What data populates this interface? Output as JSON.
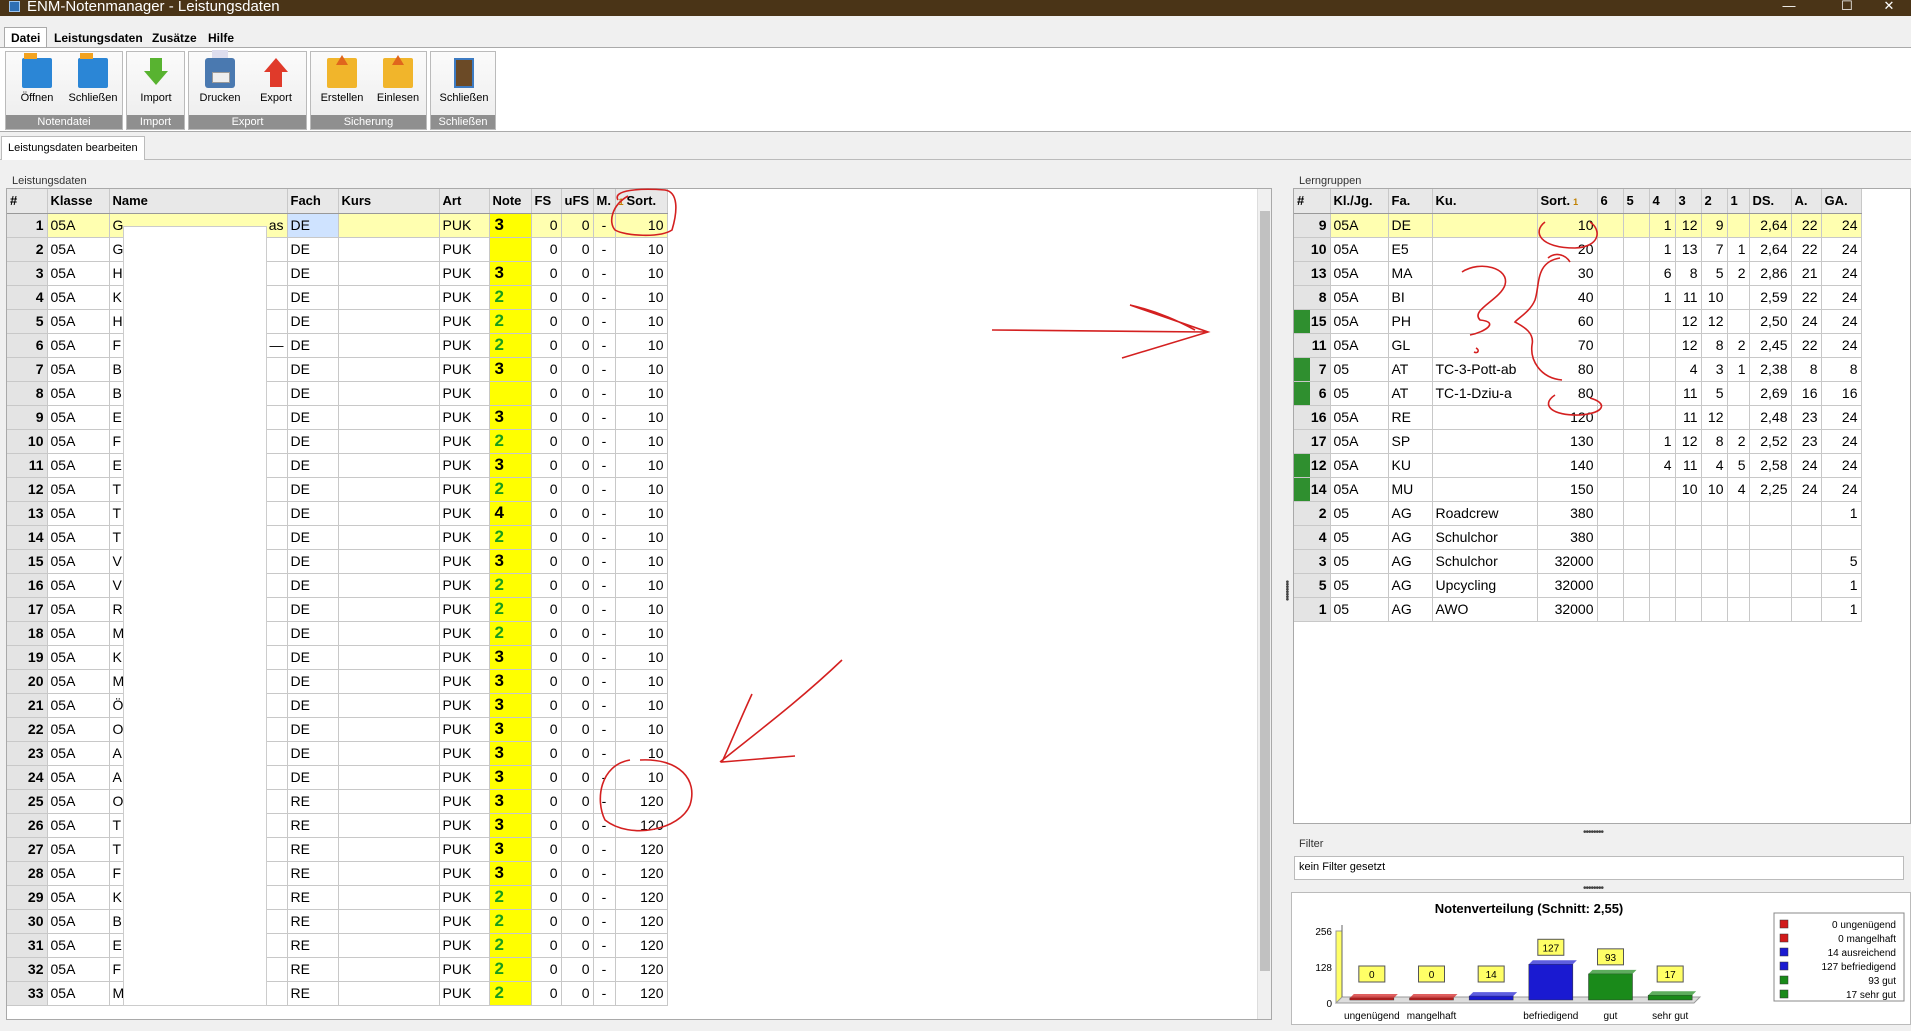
{
  "window": {
    "title": "ENM-Notenmanager - Leistungsdaten",
    "minimize": "—",
    "maximize": "☐",
    "close": "✕"
  },
  "menu": [
    "Datei",
    "Leistungsdaten",
    "Zusätze",
    "Hilfe"
  ],
  "ribbon": {
    "groups": [
      {
        "label": "Notendatei",
        "buttons": [
          {
            "label": "Öffnen",
            "icon": "folder-open-icon"
          },
          {
            "label": "Schließen",
            "icon": "folder-close-icon"
          }
        ]
      },
      {
        "label": "Import",
        "buttons": [
          {
            "label": "Import",
            "icon": "import-icon"
          }
        ]
      },
      {
        "label": "Export",
        "buttons": [
          {
            "label": "Drucken",
            "icon": "printer-icon"
          },
          {
            "label": "Export",
            "icon": "export-icon"
          }
        ]
      },
      {
        "label": "Sicherung",
        "buttons": [
          {
            "label": "Erstellen",
            "icon": "backup-create-icon"
          },
          {
            "label": "Einlesen",
            "icon": "backup-restore-icon"
          }
        ]
      },
      {
        "label": "Schließen",
        "buttons": [
          {
            "label": "Schließen",
            "icon": "door-exit-icon"
          }
        ]
      }
    ]
  },
  "subtab": "Leistungsdaten bearbeiten",
  "leistungsdaten": {
    "title": "Leistungsdaten",
    "headers": [
      "#",
      "Klasse",
      "Name",
      "Fach",
      "Kurs",
      "Art",
      "Note",
      "FS",
      "uFS",
      "M.",
      "Sort."
    ],
    "sort_indicator": "1",
    "name_fragments": {
      "1": "as",
      "6": "—"
    },
    "rows": [
      [
        "1",
        "05A",
        "G",
        "DE",
        "",
        "PUK",
        "3",
        "0",
        "0",
        "-",
        "10"
      ],
      [
        "2",
        "05A",
        "G",
        "DE",
        "",
        "PUK",
        "",
        "0",
        "0",
        "-",
        "10"
      ],
      [
        "3",
        "05A",
        "H",
        "DE",
        "",
        "PUK",
        "3",
        "0",
        "0",
        "-",
        "10"
      ],
      [
        "4",
        "05A",
        "K",
        "DE",
        "",
        "PUK",
        "2",
        "0",
        "0",
        "-",
        "10"
      ],
      [
        "5",
        "05A",
        "H",
        "DE",
        "",
        "PUK",
        "2",
        "0",
        "0",
        "-",
        "10"
      ],
      [
        "6",
        "05A",
        "F",
        "DE",
        "",
        "PUK",
        "2",
        "0",
        "0",
        "-",
        "10"
      ],
      [
        "7",
        "05A",
        "B",
        "DE",
        "",
        "PUK",
        "3",
        "0",
        "0",
        "-",
        "10"
      ],
      [
        "8",
        "05A",
        "B",
        "DE",
        "",
        "PUK",
        "",
        "0",
        "0",
        "-",
        "10"
      ],
      [
        "9",
        "05A",
        "E",
        "DE",
        "",
        "PUK",
        "3",
        "0",
        "0",
        "-",
        "10"
      ],
      [
        "10",
        "05A",
        "F",
        "DE",
        "",
        "PUK",
        "2",
        "0",
        "0",
        "-",
        "10"
      ],
      [
        "11",
        "05A",
        "E",
        "DE",
        "",
        "PUK",
        "3",
        "0",
        "0",
        "-",
        "10"
      ],
      [
        "12",
        "05A",
        "T",
        "DE",
        "",
        "PUK",
        "2",
        "0",
        "0",
        "-",
        "10"
      ],
      [
        "13",
        "05A",
        "T",
        "DE",
        "",
        "PUK",
        "4",
        "0",
        "0",
        "-",
        "10"
      ],
      [
        "14",
        "05A",
        "T",
        "DE",
        "",
        "PUK",
        "2",
        "0",
        "0",
        "-",
        "10"
      ],
      [
        "15",
        "05A",
        "V",
        "DE",
        "",
        "PUK",
        "3",
        "0",
        "0",
        "-",
        "10"
      ],
      [
        "16",
        "05A",
        "V",
        "DE",
        "",
        "PUK",
        "2",
        "0",
        "0",
        "-",
        "10"
      ],
      [
        "17",
        "05A",
        "R",
        "DE",
        "",
        "PUK",
        "2",
        "0",
        "0",
        "-",
        "10"
      ],
      [
        "18",
        "05A",
        "M",
        "DE",
        "",
        "PUK",
        "2",
        "0",
        "0",
        "-",
        "10"
      ],
      [
        "19",
        "05A",
        "K",
        "DE",
        "",
        "PUK",
        "3",
        "0",
        "0",
        "-",
        "10"
      ],
      [
        "20",
        "05A",
        "M",
        "DE",
        "",
        "PUK",
        "3",
        "0",
        "0",
        "-",
        "10"
      ],
      [
        "21",
        "05A",
        "Ö",
        "DE",
        "",
        "PUK",
        "3",
        "0",
        "0",
        "-",
        "10"
      ],
      [
        "22",
        "05A",
        "O",
        "DE",
        "",
        "PUK",
        "3",
        "0",
        "0",
        "-",
        "10"
      ],
      [
        "23",
        "05A",
        "A",
        "DE",
        "",
        "PUK",
        "3",
        "0",
        "0",
        "-",
        "10"
      ],
      [
        "24",
        "05A",
        "A",
        "DE",
        "",
        "PUK",
        "3",
        "0",
        "0",
        "-",
        "10"
      ],
      [
        "25",
        "05A",
        "O",
        "RE",
        "",
        "PUK",
        "3",
        "0",
        "0",
        "-",
        "120"
      ],
      [
        "26",
        "05A",
        "T",
        "RE",
        "",
        "PUK",
        "3",
        "0",
        "0",
        "-",
        "120"
      ],
      [
        "27",
        "05A",
        "T",
        "RE",
        "",
        "PUK",
        "3",
        "0",
        "0",
        "-",
        "120"
      ],
      [
        "28",
        "05A",
        "F",
        "RE",
        "",
        "PUK",
        "3",
        "0",
        "0",
        "-",
        "120"
      ],
      [
        "29",
        "05A",
        "K",
        "RE",
        "",
        "PUK",
        "2",
        "0",
        "0",
        "-",
        "120"
      ],
      [
        "30",
        "05A",
        "B",
        "RE",
        "",
        "PUK",
        "2",
        "0",
        "0",
        "-",
        "120"
      ],
      [
        "31",
        "05A",
        "E",
        "RE",
        "",
        "PUK",
        "2",
        "0",
        "0",
        "-",
        "120"
      ],
      [
        "32",
        "05A",
        "F",
        "RE",
        "",
        "PUK",
        "2",
        "0",
        "0",
        "-",
        "120"
      ],
      [
        "33",
        "05A",
        "M",
        "RE",
        "",
        "PUK",
        "2",
        "0",
        "0",
        "-",
        "120"
      ]
    ]
  },
  "lerngruppen": {
    "title": "Lerngruppen",
    "headers": [
      "#",
      "Kl./Jg.",
      "Fa.",
      "Ku.",
      "Sort.",
      "6",
      "5",
      "4",
      "3",
      "2",
      "1",
      "DS.",
      "A.",
      "GA."
    ],
    "sort_indicator": "1",
    "rows": [
      [
        "9",
        "05A",
        "DE",
        "",
        "10",
        "",
        "",
        "1",
        "12",
        "9",
        "",
        "2,64",
        "22",
        "24"
      ],
      [
        "10",
        "05A",
        "E5",
        "",
        "20",
        "",
        "",
        "1",
        "13",
        "7",
        "1",
        "2,64",
        "22",
        "24"
      ],
      [
        "13",
        "05A",
        "MA",
        "",
        "30",
        "",
        "",
        "6",
        "8",
        "5",
        "2",
        "2,86",
        "21",
        "24"
      ],
      [
        "8",
        "05A",
        "BI",
        "",
        "40",
        "",
        "",
        "1",
        "11",
        "10",
        "",
        "2,59",
        "22",
        "24"
      ],
      [
        "15",
        "05A",
        "PH",
        "",
        "60",
        "",
        "",
        "",
        "12",
        "12",
        "",
        "2,50",
        "24",
        "24"
      ],
      [
        "11",
        "05A",
        "GL",
        "",
        "70",
        "",
        "",
        "",
        "12",
        "8",
        "2",
        "2,45",
        "22",
        "24"
      ],
      [
        "7",
        "05",
        "AT",
        "TC-3-Pott-ab",
        "80",
        "",
        "",
        "",
        "4",
        "3",
        "1",
        "2,38",
        "8",
        "8"
      ],
      [
        "6",
        "05",
        "AT",
        "TC-1-Dziu-a",
        "80",
        "",
        "",
        "",
        "11",
        "5",
        "",
        "2,69",
        "16",
        "16"
      ],
      [
        "16",
        "05A",
        "RE",
        "",
        "120",
        "",
        "",
        "",
        "11",
        "12",
        "",
        "2,48",
        "23",
        "24"
      ],
      [
        "17",
        "05A",
        "SP",
        "",
        "130",
        "",
        "",
        "1",
        "12",
        "8",
        "2",
        "2,52",
        "23",
        "24"
      ],
      [
        "12",
        "05A",
        "KU",
        "",
        "140",
        "",
        "",
        "4",
        "11",
        "4",
        "5",
        "2,58",
        "24",
        "24"
      ],
      [
        "14",
        "05A",
        "MU",
        "",
        "150",
        "",
        "",
        "",
        "10",
        "10",
        "4",
        "2,25",
        "24",
        "24"
      ],
      [
        "2",
        "05",
        "AG",
        "Roadcrew",
        "380",
        "",
        "",
        "",
        "",
        "",
        "",
        "",
        "",
        "1"
      ],
      [
        "4",
        "05",
        "AG",
        "Schulchor",
        "380",
        "",
        "",
        "",
        "",
        "",
        "",
        "",
        "",
        ""
      ],
      [
        "3",
        "05",
        "AG",
        "Schulchor",
        "32000",
        "",
        "",
        "",
        "",
        "",
        "",
        "",
        "",
        "5"
      ],
      [
        "5",
        "05",
        "AG",
        "Upcycling",
        "32000",
        "",
        "",
        "",
        "",
        "",
        "",
        "",
        "",
        "1"
      ],
      [
        "1",
        "05",
        "AG",
        "AWO",
        "32000",
        "",
        "",
        "",
        "",
        "",
        "",
        "",
        "",
        "1"
      ]
    ],
    "green_marked": [
      "15",
      "7",
      "6",
      "12",
      "14"
    ]
  },
  "filter": {
    "title": "Filter",
    "text": "kein Filter gesetzt"
  },
  "splitter": "••••••••",
  "chart_data": {
    "type": "bar",
    "title": "Notenverteilung (Schnitt: 2,55)",
    "categories": [
      "ungenügend",
      "mangelhaft",
      "ausreichend",
      "befriedigend",
      "gut",
      "sehr gut"
    ],
    "x_tick_labels": [
      "ungenügend",
      "mangelhaft",
      "",
      "befriedigend",
      "gut",
      "sehr gut"
    ],
    "values": [
      0,
      0,
      14,
      127,
      93,
      17
    ],
    "data_labels": [
      "0",
      "0",
      "14",
      "127",
      "93",
      "17"
    ],
    "colors": [
      "#d11a1a",
      "#d11a1a",
      "#1a1ad1",
      "#1a1ad1",
      "#1a8a1a",
      "#1a8a1a"
    ],
    "yticks": [
      "256",
      "128",
      "0"
    ],
    "ylim": [
      0,
      256
    ],
    "legend": [
      "0 ungenügend",
      "0 mangelhaft",
      "14 ausreichend",
      "127 befriedigend",
      "93 gut",
      "17 sehr gut"
    ],
    "legend_position": "right"
  }
}
